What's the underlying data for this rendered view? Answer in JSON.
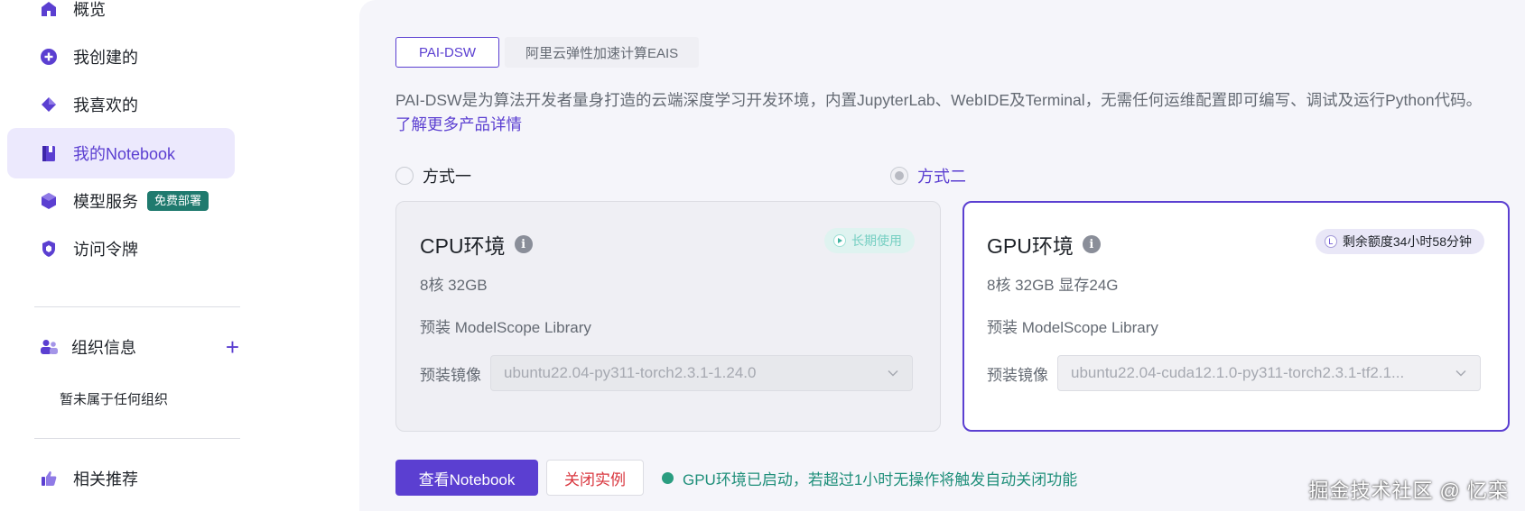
{
  "sidebar": {
    "items": [
      {
        "label": "概览",
        "icon": "home-icon"
      },
      {
        "label": "我创建的",
        "icon": "plus-circle-icon"
      },
      {
        "label": "我喜欢的",
        "icon": "diamond-icon"
      },
      {
        "label": "我的Notebook",
        "icon": "notebook-icon",
        "active": true
      },
      {
        "label": "模型服务",
        "icon": "cube-icon",
        "badge": "免费部署"
      },
      {
        "label": "访问令牌",
        "icon": "shield-icon"
      }
    ],
    "org": {
      "label": "组织信息",
      "add": "+",
      "empty": "暂未属于任何组织"
    },
    "recommend": {
      "label": "相关推荐"
    }
  },
  "main": {
    "tabs": [
      {
        "label": "PAI-DSW",
        "active": true
      },
      {
        "label": "阿里云弹性加速计算EAIS",
        "active": false
      }
    ],
    "description": "PAI-DSW是为算法开发者量身打造的云端深度学习开发环境，内置JupyterLab、WebIDE及Terminal，无需任何运维配置即可编写、调试及运行Python代码。",
    "more_link": "了解更多产品详情",
    "options": [
      {
        "radio_label": "方式一",
        "selected": false,
        "title": "CPU环境",
        "pill": "长期使用",
        "spec": "8核 32GB",
        "library": "预装 ModelScope Library",
        "image_label": "预装镜像",
        "image_value": "ubuntu22.04-py311-torch2.3.1-1.24.0"
      },
      {
        "radio_label": "方式二",
        "selected": true,
        "title": "GPU环境",
        "pill": "剩余额度34小时58分钟",
        "spec": "8核 32GB 显存24G",
        "library": "预装 ModelScope Library",
        "image_label": "预装镜像",
        "image_value": "ubuntu22.04-cuda12.1.0-py311-torch2.3.1-tf2.1..."
      }
    ],
    "actions": {
      "view_label": "查看Notebook",
      "close_label": "关闭实例",
      "status": "GPU环境已启动，若超过1小时无操作将触发自动关闭功能"
    }
  },
  "watermark": "掘金技术社区 @ 忆栾",
  "colors": {
    "accent": "#5b3fd1",
    "success": "#2a9d80",
    "danger": "#d9363e",
    "badge": "#1f7a6e"
  }
}
